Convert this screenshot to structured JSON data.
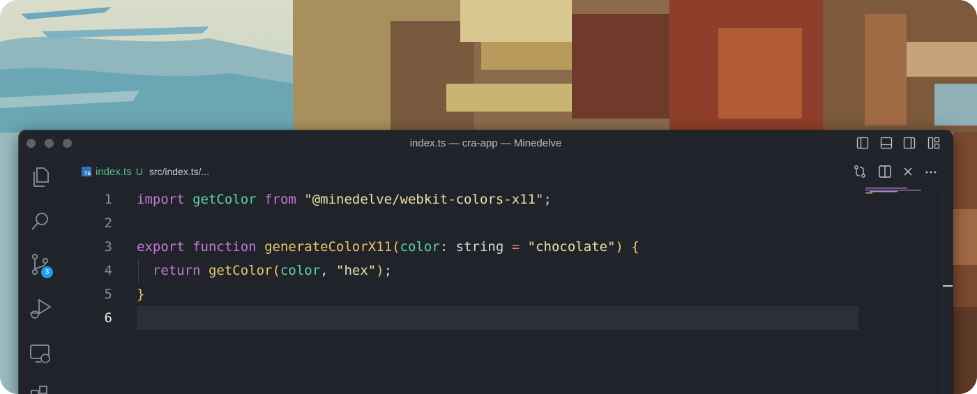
{
  "window": {
    "title": "index.ts — cra-app — Minedelve"
  },
  "activity_bar": {
    "scm_badge_count": "3"
  },
  "tab": {
    "icon_label": "TS",
    "file_name": "index.ts",
    "status": "U",
    "path": "src/index.ts/..."
  },
  "editor": {
    "active_line": 6,
    "lines": [
      {
        "number": "1",
        "tokens": [
          {
            "t": "import",
            "c": "kw"
          },
          {
            "t": " "
          },
          {
            "t": "getColor",
            "c": "fn"
          },
          {
            "t": " "
          },
          {
            "t": "from",
            "c": "kw"
          },
          {
            "t": " "
          },
          {
            "t": "\"@minedelve/webkit-colors-x11\"",
            "c": "str"
          },
          {
            "t": ";"
          }
        ]
      },
      {
        "number": "2",
        "tokens": []
      },
      {
        "number": "3",
        "tokens": [
          {
            "t": "export",
            "c": "kw"
          },
          {
            "t": " "
          },
          {
            "t": "function",
            "c": "kw"
          },
          {
            "t": " "
          },
          {
            "t": "generateColorX11",
            "c": "fnd"
          },
          {
            "t": "(",
            "c": "paren"
          },
          {
            "t": "color",
            "c": "param"
          },
          {
            "t": ": "
          },
          {
            "t": "string",
            "c": "ty"
          },
          {
            "t": " "
          },
          {
            "t": "=",
            "c": "op"
          },
          {
            "t": " "
          },
          {
            "t": "\"chocolate\"",
            "c": "str"
          },
          {
            "t": ")",
            "c": "paren"
          },
          {
            "t": " "
          },
          {
            "t": "{",
            "c": "brace"
          }
        ]
      },
      {
        "number": "4",
        "tokens": [
          {
            "t": "  "
          },
          {
            "t": "return",
            "c": "kw"
          },
          {
            "t": " "
          },
          {
            "t": "getColor",
            "c": "fnd"
          },
          {
            "t": "(",
            "c": "paren"
          },
          {
            "t": "color",
            "c": "param"
          },
          {
            "t": ", "
          },
          {
            "t": "\"hex\"",
            "c": "str"
          },
          {
            "t": ")",
            "c": "paren"
          },
          {
            "t": ";"
          }
        ]
      },
      {
        "number": "5",
        "tokens": [
          {
            "t": "}",
            "c": "brace"
          }
        ]
      },
      {
        "number": "6",
        "tokens": []
      }
    ]
  },
  "colors": {
    "editor_bg": "#21232a",
    "keyword": "#c678dd",
    "function": "#5fd0a6",
    "string": "#e8e0a8",
    "badge": "#1e9ef0"
  }
}
